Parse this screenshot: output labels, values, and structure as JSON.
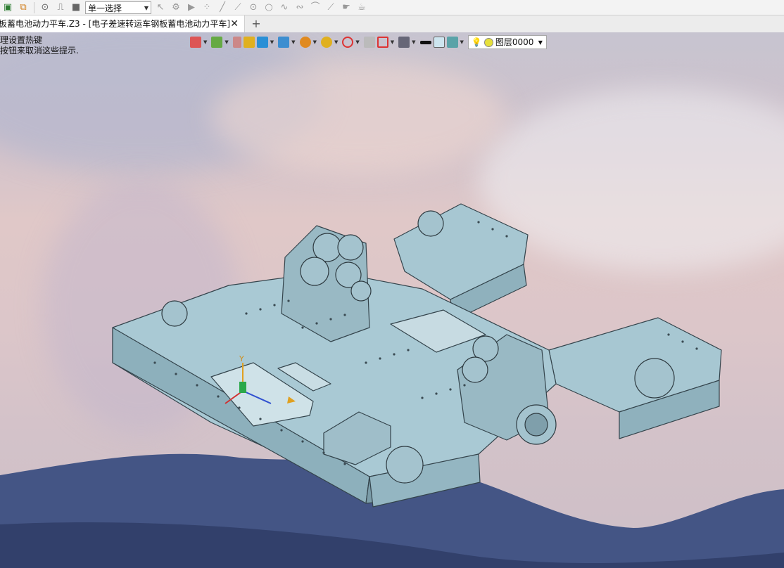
{
  "toolbar": {
    "selection_mode": "单一选择"
  },
  "tabs": [
    {
      "label": "板蓄电池动力平车.Z3 - [电子差速转运车钢板蓄电池动力平车]"
    }
  ],
  "hint": {
    "line1": "理设置热键",
    "line2": "按钮来取消这些提示."
  },
  "layer_select": {
    "value": "图层0000"
  },
  "viewport": {
    "axis_label_y": "Y"
  },
  "colors": {
    "model_fill": "#a9c8d3",
    "model_edge": "#3b4a52",
    "ground": "#3f4e78"
  }
}
